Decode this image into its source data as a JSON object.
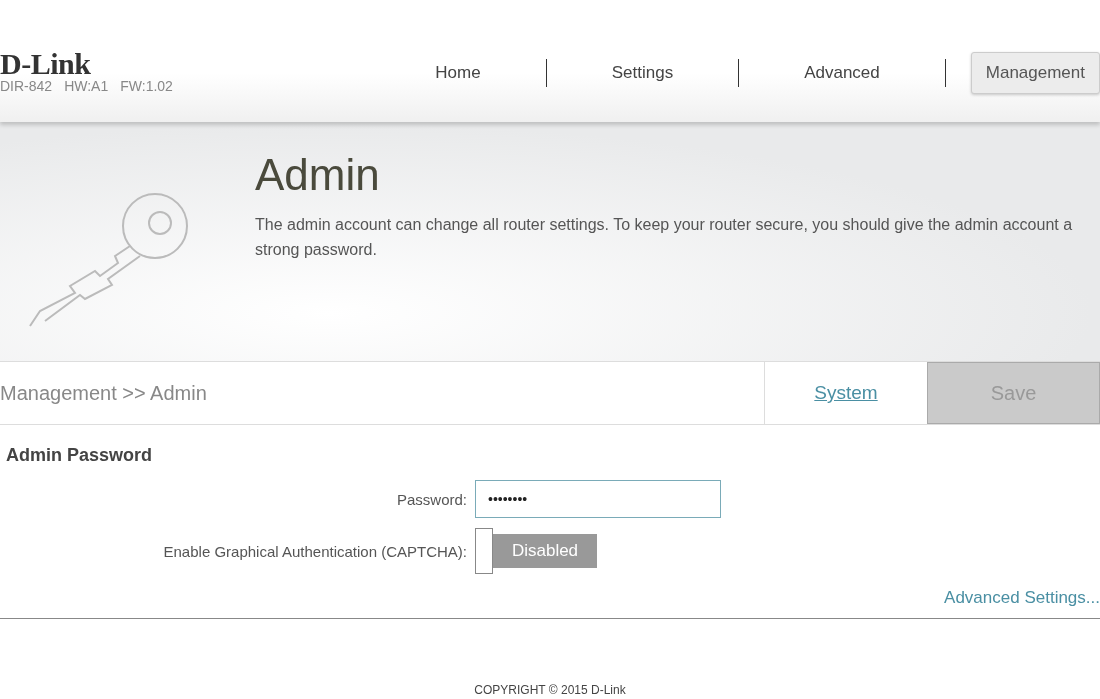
{
  "brand": {
    "logo": "D-Link",
    "model": "DIR-842",
    "hardware": "HW:A1",
    "firmware": "FW:1.02"
  },
  "nav": [
    {
      "label": "Home",
      "selected": false
    },
    {
      "label": "Settings",
      "selected": false
    },
    {
      "label": "Advanced",
      "selected": false
    },
    {
      "label": "Management",
      "selected": true
    }
  ],
  "banner": {
    "title": "Admin",
    "description": "The admin account can change all router settings. To keep your router secure, you should give the admin account a strong password."
  },
  "breadcrumb": "Management >> Admin",
  "actions": {
    "link": "System",
    "save": {
      "label": "Save",
      "disabled": true
    }
  },
  "section": {
    "title": "Admin Password",
    "fields": [
      {
        "kind": "password",
        "label": "Password:",
        "value": "••••••••"
      },
      {
        "kind": "toggle",
        "label": "Enable Graphical Authentication (CAPTCHA):",
        "on": false,
        "state_label": "Disabled"
      }
    ]
  },
  "advanced_link": "Advanced Settings...",
  "footer": "COPYRIGHT © 2015 D-Link"
}
